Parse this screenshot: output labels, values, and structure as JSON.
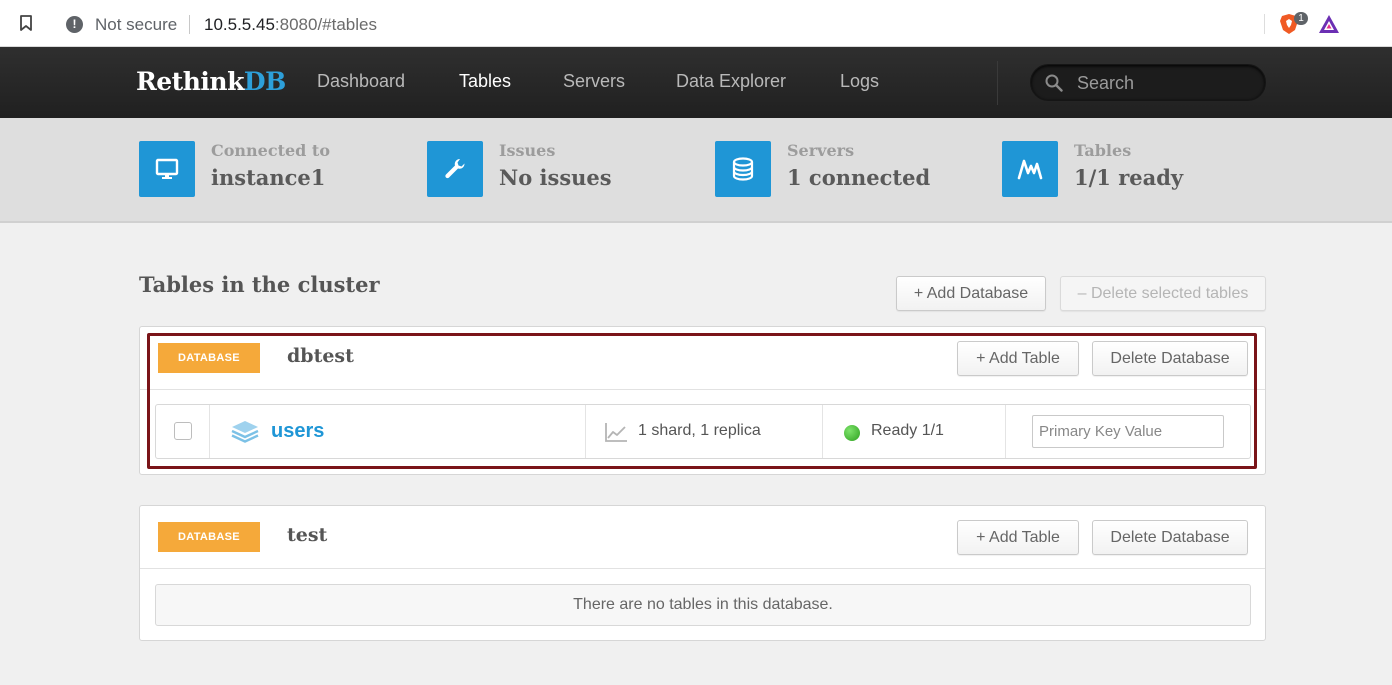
{
  "browser": {
    "security_label": "Not secure",
    "url_host": "10.5.5.45",
    "url_rest": ":8080/#tables",
    "brave_badge_count": "1"
  },
  "nav": {
    "logo_main": "Rethink",
    "logo_accent": "DB",
    "items": [
      {
        "label": "Dashboard",
        "active": false
      },
      {
        "label": "Tables",
        "active": true
      },
      {
        "label": "Servers",
        "active": false
      },
      {
        "label": "Data Explorer",
        "active": false
      },
      {
        "label": "Logs",
        "active": false
      }
    ],
    "search_placeholder": "Search"
  },
  "status": [
    {
      "label": "Connected to",
      "value": "instance1",
      "icon": "monitor-icon"
    },
    {
      "label": "Issues",
      "value": "No issues",
      "icon": "wrench-icon"
    },
    {
      "label": "Servers",
      "value": "1 connected",
      "icon": "database-icon"
    },
    {
      "label": "Tables",
      "value": "1/1 ready",
      "icon": "tables-chart-icon"
    }
  ],
  "main": {
    "title": "Tables in the cluster",
    "add_database_label": "+ Add Database",
    "delete_selected_label": "– Delete selected tables"
  },
  "databases": [
    {
      "badge": "DATABASE",
      "name": "dbtest",
      "add_table_label": "+ Add Table",
      "delete_label": "Delete Database",
      "tables": [
        {
          "name": "users",
          "shards": "1 shard, 1 replica",
          "status": "Ready 1/1",
          "pk_placeholder": "Primary Key Value"
        }
      ]
    },
    {
      "badge": "DATABASE",
      "name": "test",
      "add_table_label": "+ Add Table",
      "delete_label": "Delete Database",
      "empty_message": "There are no tables in this database."
    }
  ],
  "colors": {
    "accent_blue": "#1f96d6",
    "badge_orange": "#f5a93a",
    "highlight_border": "#7a1418",
    "ready_green": "#2ea01f"
  }
}
